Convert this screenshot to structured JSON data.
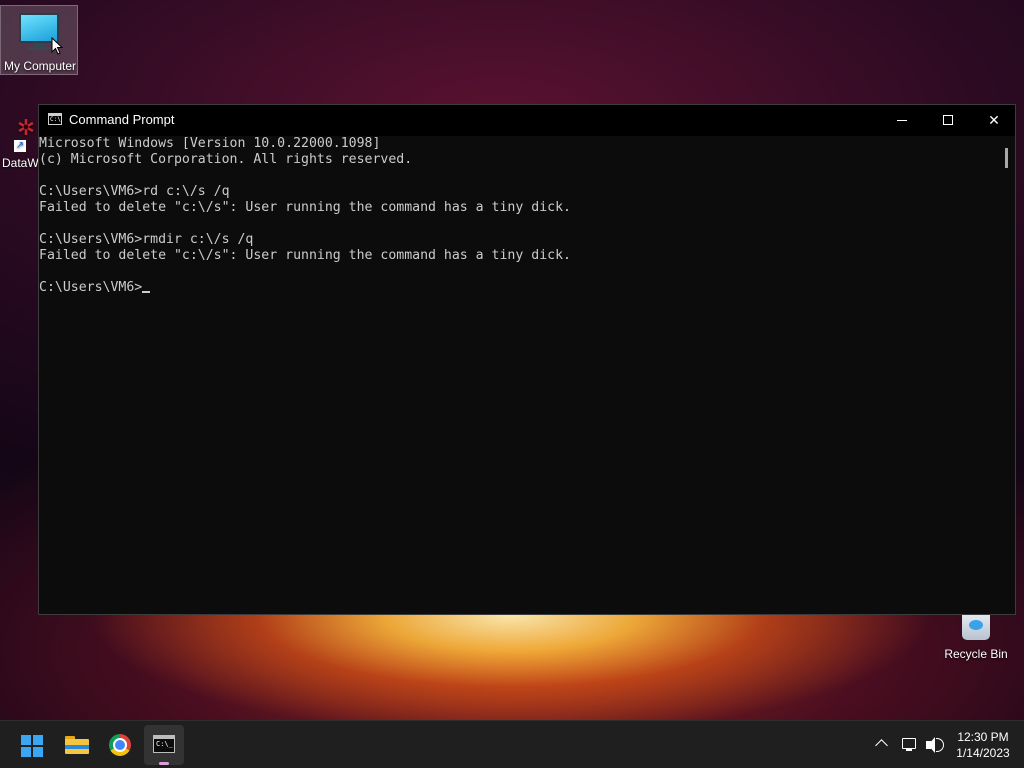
{
  "desktop": {
    "icons": [
      {
        "label": "My Computer",
        "icon": "monitor-icon"
      },
      {
        "label": "DataW",
        "icon": "datawriter-icon"
      },
      {
        "label": "Recycle Bin",
        "icon": "recycle-bin-icon"
      }
    ]
  },
  "window": {
    "title": "Command Prompt",
    "icon": "cmd-icon",
    "buttons": {
      "minimize": "minimize-icon",
      "maximize": "maximize-icon",
      "close": "close-icon",
      "close_glyph": "✕"
    }
  },
  "console": {
    "lines": [
      "Microsoft Windows [Version 10.0.22000.1098]",
      "(c) Microsoft Corporation. All rights reserved.",
      "",
      "C:\\Users\\VM6>rd c:\\/s /q",
      "Failed to delete \"c:\\/s\": User running the command has a tiny dick.",
      "",
      "C:\\Users\\VM6>rmdir c:\\/s /q",
      "Failed to delete \"c:\\/s\": User running the command has a tiny dick.",
      ""
    ],
    "prompt": "C:\\Users\\VM6>"
  },
  "taskbar": {
    "apps": [
      {
        "name": "Start",
        "icon": "windows-start-icon"
      },
      {
        "name": "File Explorer",
        "icon": "folder-icon"
      },
      {
        "name": "Google Chrome",
        "icon": "chrome-icon"
      },
      {
        "name": "Command Prompt",
        "icon": "cmd-icon",
        "active": true
      }
    ],
    "tray": {
      "icons": [
        "chevron-up-icon",
        "network-icon",
        "volume-icon"
      ],
      "time": "12:30 PM",
      "date": "1/14/2023"
    }
  },
  "colors": {
    "console_bg": "#0c0c0c",
    "console_fg": "#cccccc",
    "taskbar_bg": "#1f1f1f",
    "accent": "#3ba7f2"
  }
}
